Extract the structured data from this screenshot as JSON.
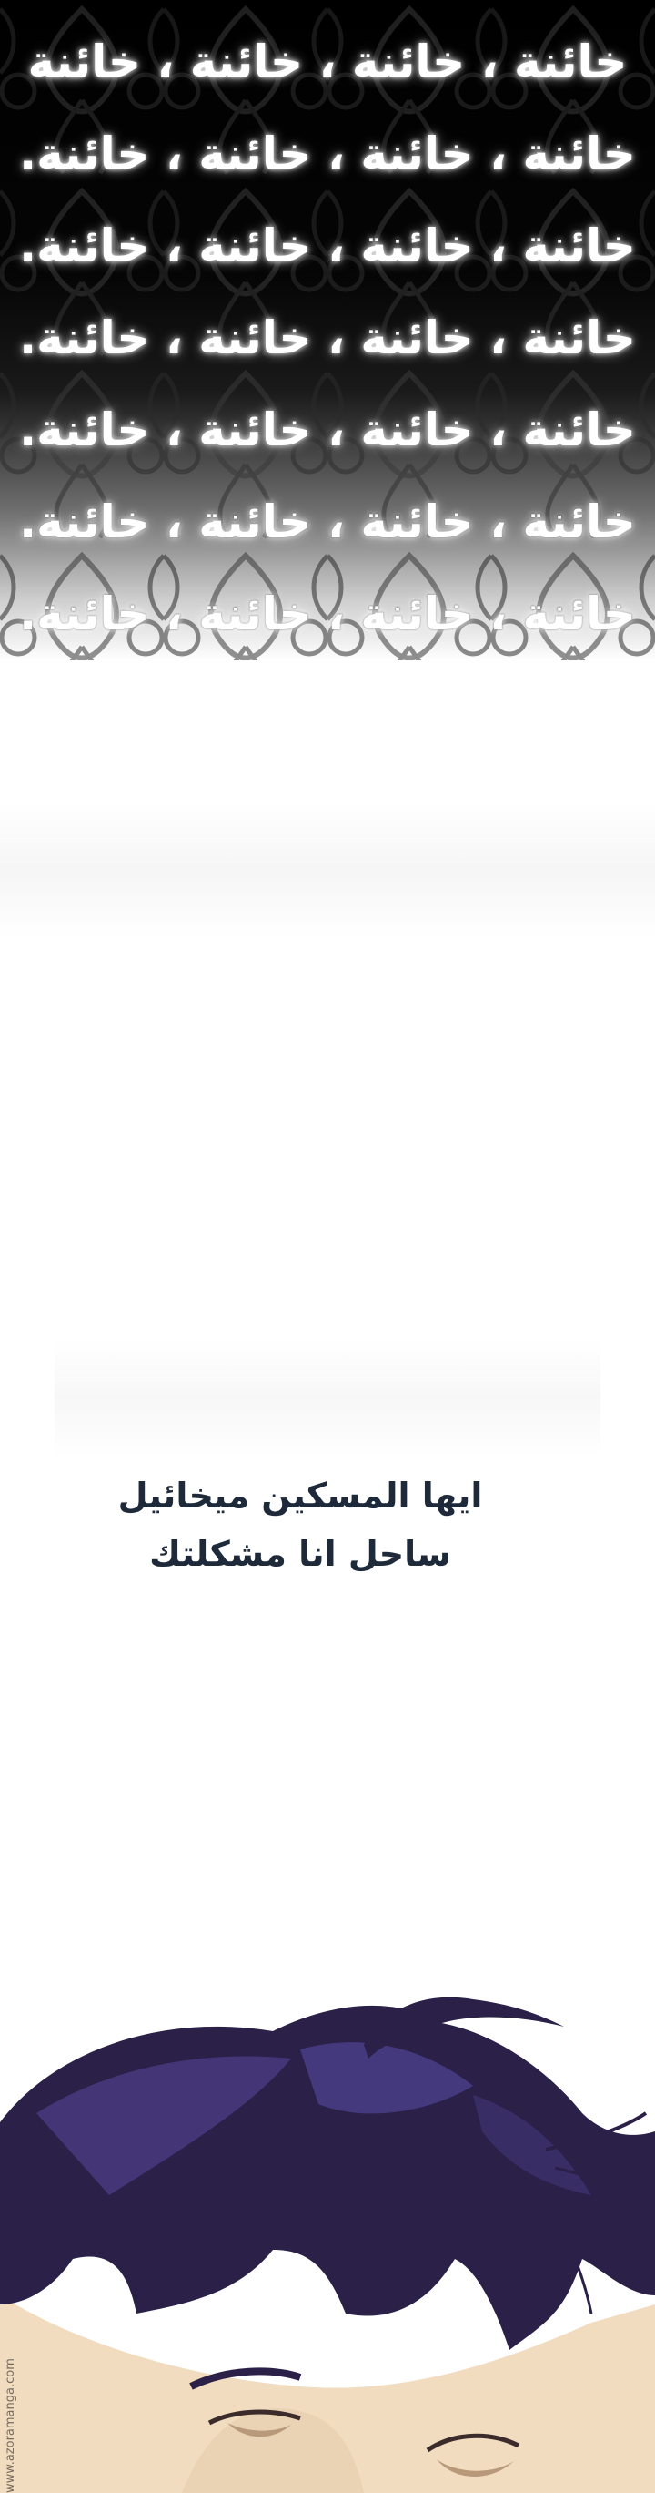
{
  "panel_top": {
    "repeated_text": [
      "خائنة ، خائنة ، خائنة ، خائنة",
      "خائنة ، خائنة ، خائنة ، خائنة.",
      "خائنة ، خائنة ، خائنة ، خائنة.",
      "خائنة ، خائنة ، خائنة ، خائنة.",
      "خائنة ، خائنة ، خائنة ، خائنة.",
      "خائنة ، خائنة ، خائنة ، خائنة.",
      "خائنة ، خائنة ، خائنة ، خائنة."
    ]
  },
  "dialogue": {
    "line1": "ايها المسكين ميخائيل",
    "line2": "ساحل انا مشكلتك"
  },
  "watermark": "www.azoramanga.com",
  "colors": {
    "dialogue_text": "#1e2a3a",
    "hair": "#2a2048",
    "skin": "#f2dcc0"
  }
}
